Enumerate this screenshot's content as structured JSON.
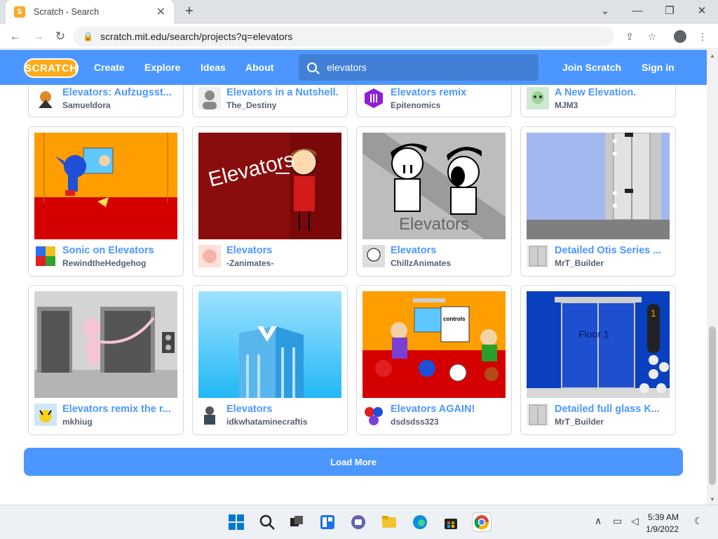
{
  "browser": {
    "tab_title": "Scratch - Search",
    "favicon": "S",
    "url": "scratch.mit.edu/search/projects?q=elevators",
    "tab_close": "✕",
    "new_tab": "+",
    "minimize": "⌄",
    "restore": "—",
    "maximize": "❐",
    "close": "✕"
  },
  "scratch_nav": {
    "logo": "SCRATCH",
    "links": [
      "Create",
      "Explore",
      "Ideas",
      "About"
    ],
    "search_value": "elevators",
    "join": "Join Scratch",
    "signin": "Sign in"
  },
  "projects": [
    {
      "title": "Elevators: Aufzugsst...",
      "user": "Samueldora"
    },
    {
      "title": "Elevators in a Nutshell.",
      "user": "The_Destiny"
    },
    {
      "title": "Elevators remix",
      "user": "Epitenomics"
    },
    {
      "title": "A New Elevation.",
      "user": "MJM3"
    },
    {
      "title": "Sonic on Elevators",
      "user": "RewindtheHedgehog"
    },
    {
      "title": "Elevators",
      "user": "-Zanimates-"
    },
    {
      "title": "Elevators",
      "user": "ChillzAnimates"
    },
    {
      "title": "Detailed Otis Series ...",
      "user": "MrT_Builder"
    },
    {
      "title": "Elevators remix the r...",
      "user": "mkhiug"
    },
    {
      "title": "Elevators",
      "user": "idkwhataminecraftis"
    },
    {
      "title": "Elevators AGAIN!",
      "user": "dsdsdss323"
    },
    {
      "title": "Detailed full glass K...",
      "user": "MrT_Builder"
    }
  ],
  "thumb_text": {
    "elevators_red": "Elevators",
    "elevators_gray": "Elevators",
    "controls": "controls",
    "floor": "Floor 1"
  },
  "load_more": "Load More",
  "taskbar": {
    "time": "5:39 AM",
    "date": "1/9/2022"
  },
  "colors": {
    "scratch_blue": "#4c97ff",
    "scratch_orange": "#ffab19"
  }
}
